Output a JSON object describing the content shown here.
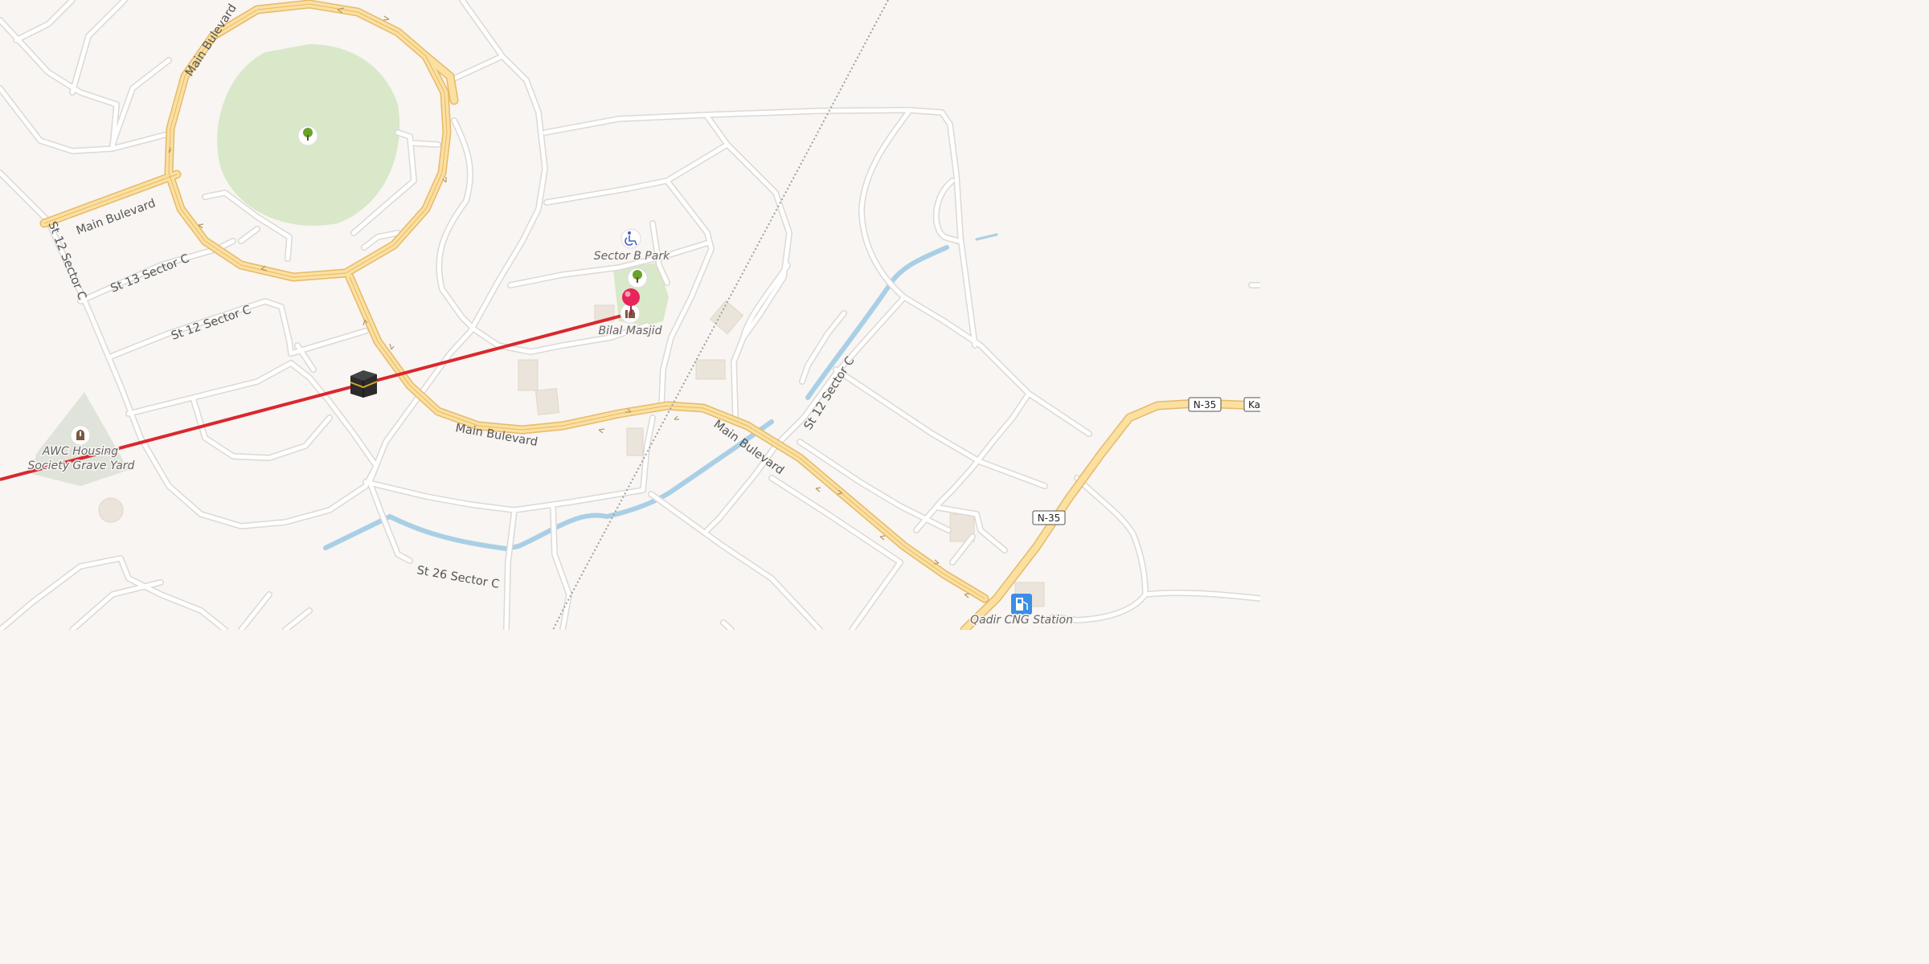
{
  "map": {
    "roads": {
      "main_bulevard_labels": [
        "Main Bulevard",
        "Main Bulevard",
        "Main Bulevard",
        "Main Bulevard"
      ],
      "street_labels": [
        "St 12 Sector C",
        "St 13 Sector C",
        "St 12 Sector C",
        "St 26 Sector C",
        "St 12 Sector C"
      ],
      "highway_shields": [
        "N-35",
        "N-35"
      ],
      "cut_label": "Ka"
    },
    "pois": {
      "park": "Sector B Park",
      "mosque": "Bilal Masjid",
      "graveyard": "AWC Housing Society Grave Yard",
      "graveyard_line1": "AWC Housing",
      "graveyard_line2": "Society Grave Yard",
      "fuel": "Qadir CNG Station"
    },
    "icons": [
      "tree-icon",
      "wheelchair-icon",
      "mosque-icon",
      "grave-icon",
      "fuel-icon",
      "kaaba-icon",
      "pin-icon"
    ],
    "colors": {
      "background": "#f8f5f2",
      "road": "#ffffff",
      "road_casing": "#d9d6d2",
      "main_road": "#fbe0a0",
      "main_road_casing": "#e6b96a",
      "park": "#d8e8c8",
      "water": "#a9cfe6",
      "qibla_line": "#d9282d",
      "pin": "#e8245a",
      "poi_icon": "#7a5a3c"
    }
  }
}
